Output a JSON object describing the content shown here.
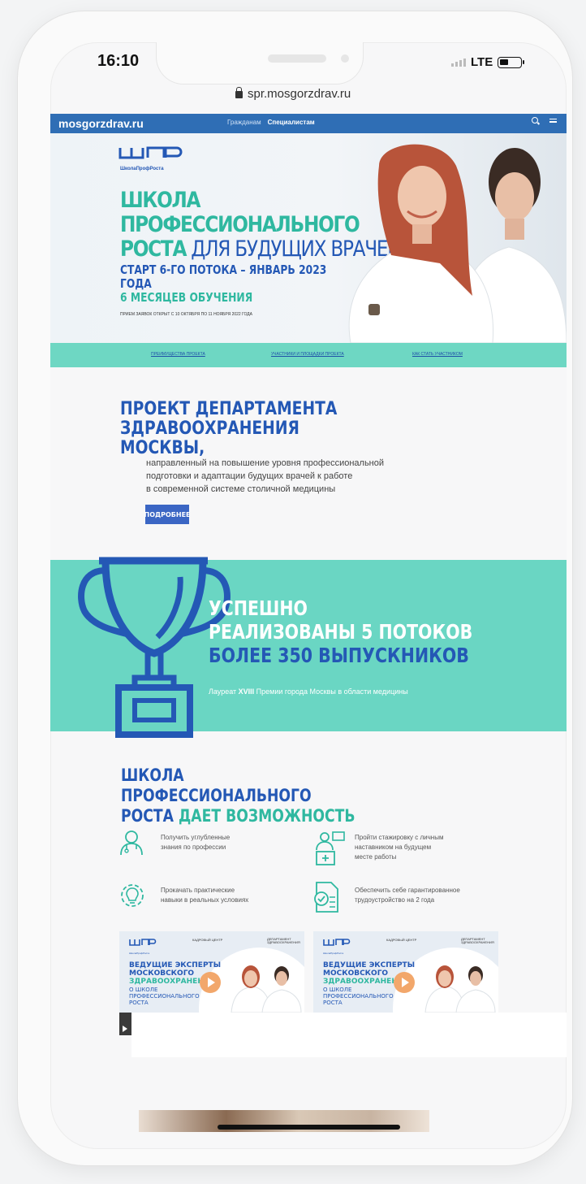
{
  "status_bar": {
    "time": "16:10",
    "network": "LTE"
  },
  "browser": {
    "url": "spr.mosgorzdrav.ru"
  },
  "site_nav": {
    "logo": "mosgorzdrav.ru",
    "links": [
      "Гражданам",
      "Специалистам"
    ],
    "active_link": "Специалистам",
    "icons": [
      "search-icon",
      "menu-icon"
    ]
  },
  "hero": {
    "logo_caption": "ШколаПрофРоста",
    "title_line1": "ШКОЛА ПРОФЕССИОНАЛЬНОГО",
    "title_line2_teal": "РОСТА",
    "title_line2_blue": " ДЛЯ БУДУЩИХ ВРАЧЕЙ",
    "start_line": "СТАРТ 6-ГО ПОТОКА – ЯНВАРЬ 2023 ГОДА",
    "duration_line": "6 МЕСЯЦЕВ ОБУЧЕНИЯ",
    "note": "ПРИЕМ ЗАЯВОК ОТКРЫТ С 10 ОКТЯБРЯ ПО 11 НОЯБРЯ 2022 ГОДА"
  },
  "tabs": [
    "ПРЕИМУЩЕСТВА ПРОЕКТА",
    "УЧАСТНИКИ И ПЛОЩАДКИ ПРОЕКТА",
    "КАК СТАТЬ УЧАСТНИКОМ"
  ],
  "project": {
    "title_line1": "ПРОЕКТ ДЕПАРТАМЕНТА",
    "title_line2": "ЗДРАВООХРАНЕНИЯ МОСКВЫ,",
    "text_line1": "направленный на повышение уровня профессиональной",
    "text_line2": "подготовки и адаптации будущих врачей к работе",
    "text_line3": "в современной системе столичной медицины",
    "button": "ПОДРОБНЕЕ"
  },
  "achievements": {
    "line1": "УСПЕШНО",
    "line2": "РЕАЛИЗОВАНЫ 5 ПОТОКОВ",
    "line3": "БОЛЕЕ 350 ВЫПУСКНИКОВ",
    "laureate_prefix": "Лауреат ",
    "laureate_bold": "XVIII",
    "laureate_suffix": " Премии города Москвы в области медицины"
  },
  "opportunities": {
    "title_line1": "ШКОЛА ПРОФЕССИОНАЛЬНОГО",
    "title_line2_blue": "РОСТА ",
    "title_line2_teal": "ДАЕТ ВОЗМОЖНОСТЬ",
    "items": [
      {
        "icon": "doctor-icon",
        "line1": "Получить углубленные",
        "line2": "знания по профессии",
        "line3": ""
      },
      {
        "icon": "mentor-icon",
        "line1": "Пройти стажировку с личным",
        "line2": "наставником на будущем",
        "line3": "месте работы"
      },
      {
        "icon": "gear-bulb-icon",
        "line1": "Прокачать практические",
        "line2": "навыки в реальных условиях",
        "line3": ""
      },
      {
        "icon": "document-check-icon",
        "line1": "Обеспечить себе гарантированное",
        "line2": "трудоустройство на 2 года",
        "line3": ""
      }
    ]
  },
  "videos": [
    {
      "logo_caption": "ШколаПрофРоста",
      "partner1": "КАДРОВЫЙ ЦЕНТР",
      "partner2": "ДЕПАРТАМЕНТ ЗДРАВООХРАНЕНИЯ",
      "title_line1": "ВЕДУЩИЕ ЭКСПЕРТЫ",
      "title_line2": "МОСКОВСКОГО",
      "title_line3": "ЗДРАВООХРАНЕНИЯ",
      "sub_line1": "О ШКОЛЕ",
      "sub_line2": "ПРОФЕССИОНАЛЬНОГО",
      "sub_line3": "РОСТА"
    },
    {
      "logo_caption": "ШколаПрофРоста",
      "partner1": "КАДРОВЫЙ ЦЕНТР",
      "partner2": "ДЕПАРТАМЕНТ ЗДРАВООХРАНЕНИЯ",
      "title_line1": "ВЕДУЩИЕ ЭКСПЕРТЫ",
      "title_line2": "МОСКОВСКОГО",
      "title_line3": "ЗДРАВООХРАНЕНИЯ",
      "sub_line1": "О ШКОЛЕ",
      "sub_line2": "ПРОФЕССИОНАЛЬНОГО",
      "sub_line3": "РОСТА"
    }
  ],
  "colors": {
    "brand_blue": "#2458b5",
    "nav_blue": "#2f6eb5",
    "teal": "#2fb8a0",
    "teal_band": "#6ad6c3",
    "play_orange": "#f2a76b"
  }
}
